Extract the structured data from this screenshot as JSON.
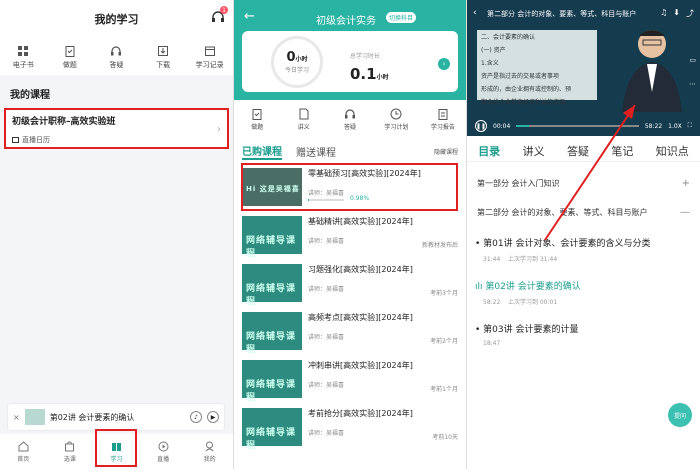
{
  "panel1": {
    "title": "我的学习",
    "badge": "1",
    "quick_items": [
      "电子书",
      "做题",
      "答疑",
      "下载",
      "学习记录"
    ],
    "section_title": "我的课程",
    "course": {
      "name": "初级会计职称–高效实验班",
      "sub": "直播日历"
    },
    "mini_player": {
      "close": "×",
      "text": "第02讲   会计要素的确认"
    },
    "tabs": [
      "首页",
      "选课",
      "学习",
      "直播",
      "我的"
    ]
  },
  "panel2": {
    "title": "初级会计实务",
    "tag": "切换科目",
    "today_value": "0",
    "today_unit": "小时",
    "today_label": "今日学习",
    "total_label": "总学习时长",
    "total_value": "0.1",
    "total_unit": "小时",
    "quick_items": [
      "做题",
      "讲义",
      "答疑",
      "学习计划",
      "学习报告"
    ],
    "tab_active": "已购课程",
    "tab_other": "赠送课程",
    "hide_label": "隐藏课程",
    "courses": [
      {
        "name": "零基础预习[高效实验][2024年]",
        "teacher": "讲师：吴福喜",
        "progress": "0.98%",
        "right": "",
        "thumb": "Hi 这是吴福喜"
      },
      {
        "name": "基础精讲[高效实验][2024年]",
        "teacher": "讲师：吴福喜",
        "progress": "",
        "right": "新教材发布后",
        "thumb": "网络辅导课程"
      },
      {
        "name": "习题强化[高效实验][2024年]",
        "teacher": "讲师：吴福喜",
        "progress": "",
        "right": "考前3个月",
        "thumb": "网络辅导课程"
      },
      {
        "name": "高频考点[高效实验][2024年]",
        "teacher": "讲师：吴福喜",
        "progress": "",
        "right": "考前2个月",
        "thumb": "网络辅导课程"
      },
      {
        "name": "冲刺串讲[高效实验][2024年]",
        "teacher": "讲师：吴福喜",
        "progress": "",
        "right": "考前1个月",
        "thumb": "网络辅导课程"
      },
      {
        "name": "考前抢分[高效实验][2024年]",
        "teacher": "讲师：吴福喜",
        "progress": "",
        "right": "考前10天",
        "thumb": "网络辅导课程"
      }
    ]
  },
  "panel3": {
    "video_title": "第二部分  会计的对象、要素、等式、科目与账户",
    "board_lines": [
      "二、会计要素的确认",
      "(一) 资产",
      "1.含义",
      "资产是指过去的交易或者事项",
      "形成的，由企业拥有或控制的、预",
      "期会给企业带来经济利益的资源。"
    ],
    "time_start": "00:04",
    "time_end": "58:22",
    "speed": "1.0X",
    "tabs": [
      "目录",
      "讲义",
      "答疑",
      "笔记",
      "知识点"
    ],
    "parts": [
      {
        "text": "第一部分  会计入门知识",
        "sign": "+"
      },
      {
        "text": "第二部分  会计的对象、要素、等式、科目与账户",
        "sign": "—"
      }
    ],
    "lessons": [
      {
        "title": "第01讲   会计对象、会计要素的含义与分类",
        "duration": "31:44",
        "note": "上次学习到 31:44"
      },
      {
        "title": "第02讲   会计要素的确认",
        "duration": "58:22",
        "note": "上次学习到 00:01"
      },
      {
        "title": "第03讲   会计要素的计量",
        "duration": "18:47",
        "note": ""
      }
    ],
    "ask": "提问"
  }
}
